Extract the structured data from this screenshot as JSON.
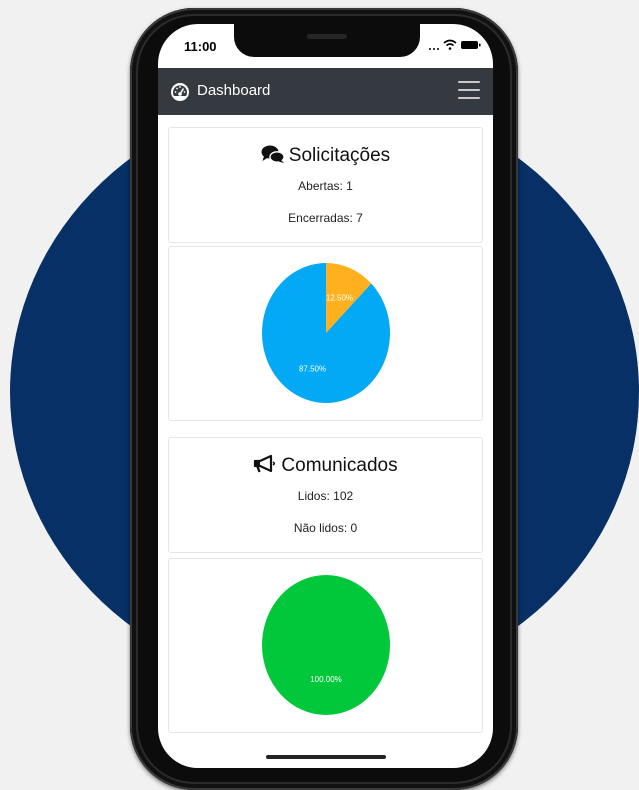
{
  "status_bar": {
    "time": "11:00"
  },
  "navbar": {
    "title": "Dashboard",
    "icon": "tachometer-icon",
    "menu_icon": "hamburger-icon"
  },
  "colors": {
    "background_circle": "#073166",
    "navbar": "#343a40",
    "slice_open": "#feb01e",
    "slice_closed": "#03a9f4",
    "slice_read": "#00c83a"
  },
  "solicitacoes": {
    "title": "Solicitações",
    "icon": "comments-icon",
    "open_text": "Abertas: 1",
    "closed_text": "Encerradas: 7"
  },
  "comunicados": {
    "title": "Comunicados",
    "icon": "bullhorn-icon",
    "read_text": "Lidos: 102",
    "unread_text": "Não lidos: 0"
  },
  "chart_data": [
    {
      "type": "pie",
      "categories": [
        "Abertas",
        "Encerradas"
      ],
      "values": [
        1,
        7
      ],
      "labels": [
        "12.50%",
        "87.50%"
      ],
      "colors": [
        "#feb01e",
        "#03a9f4"
      ]
    },
    {
      "type": "pie",
      "categories": [
        "Lidos",
        "Não lidos"
      ],
      "values": [
        102,
        0
      ],
      "labels": [
        "100.00%",
        ""
      ],
      "colors": [
        "#00c83a",
        "#feb01e"
      ]
    }
  ]
}
